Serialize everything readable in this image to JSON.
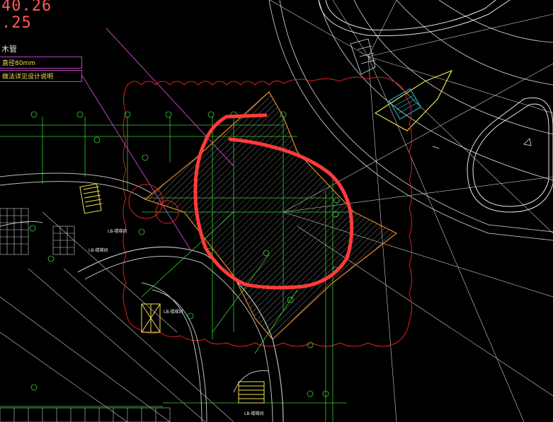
{
  "drawing": {
    "elevations": [
      "40.26",
      ".25"
    ],
    "legend": {
      "title": "木管",
      "rows": [
        "直径80mm",
        "做法详见设计说明"
      ]
    },
    "room_tags": [
      "LB-楼梯间",
      "LB-楼梯间",
      "LB-楼梯间",
      "LB-楼梯间"
    ]
  },
  "colors": {
    "background": "#000000",
    "grid": "#d8d8d8",
    "axis": "#2fd02f",
    "hatch_outline": "#e08a2a",
    "revision_cloud": "#e02020",
    "markup_circle": "#ff3b3b",
    "callout": "#c040c0",
    "stair": "#f0e050",
    "cyan_detail": "#20d0e0"
  },
  "icons": [
    "revision-cloud-icon",
    "markup-circle-icon",
    "north-arrow-icon"
  ]
}
